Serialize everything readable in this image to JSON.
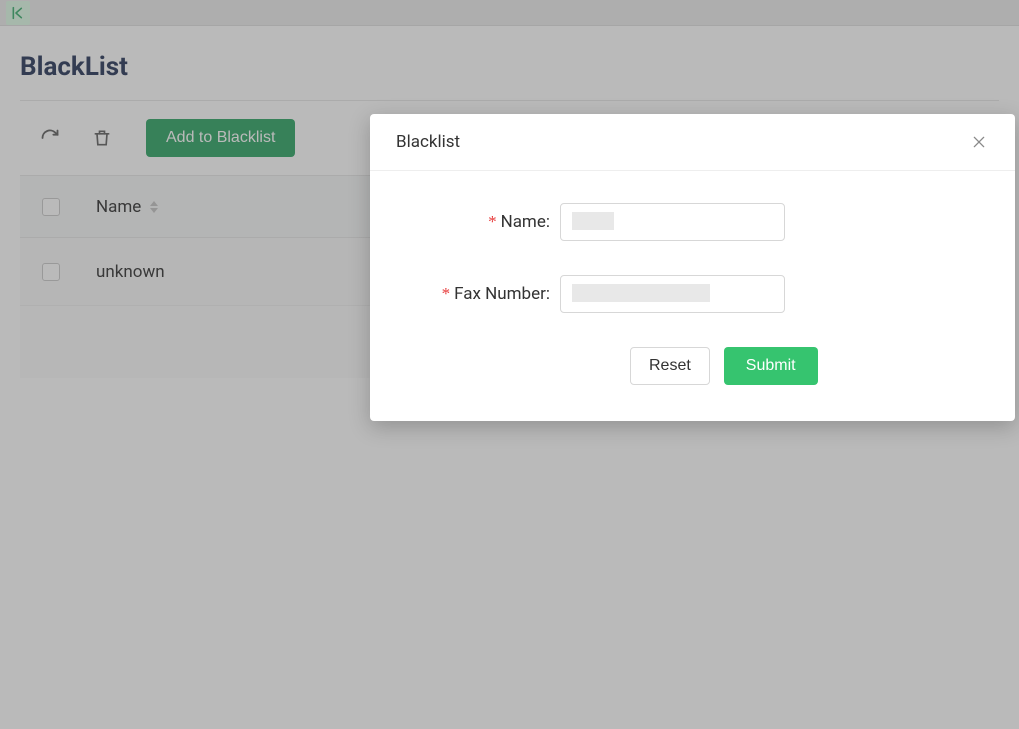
{
  "page": {
    "title": "BlackList"
  },
  "toolbar": {
    "add_label": "Add to Blacklist"
  },
  "table": {
    "columns": {
      "name": "Name"
    },
    "rows": [
      {
        "name": "unknown"
      }
    ]
  },
  "modal": {
    "title": "Blacklist",
    "fields": {
      "name": {
        "label": "Name",
        "required": true,
        "value": ""
      },
      "fax": {
        "label": "Fax Number",
        "required": true,
        "value": ""
      }
    },
    "actions": {
      "reset": "Reset",
      "submit": "Submit"
    }
  }
}
